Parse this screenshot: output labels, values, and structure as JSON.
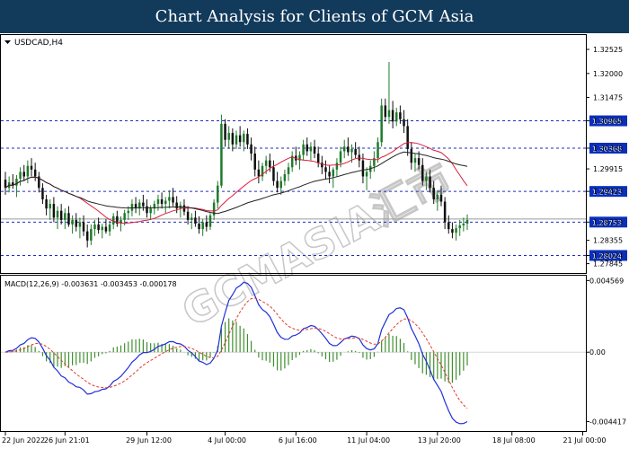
{
  "banner": {
    "title": "Chart Analysis for Clients of GCM Asia"
  },
  "watermark": {
    "text": "GCMASIA汇市"
  },
  "chart_data": [
    {
      "type": "candlestick",
      "symbol_label": "USDCAD,H4",
      "ylim": [
        1.277,
        1.328
      ],
      "y_ticks": [
        1.32525,
        1.32,
        1.31475,
        1.30965,
        1.30368,
        1.29915,
        1.29423,
        1.28753,
        1.28355,
        1.28024,
        1.27845
      ],
      "price_levels": [
        {
          "value": 1.30965,
          "label": "1.30965",
          "style": "dashed",
          "color": "#1e2dbf"
        },
        {
          "value": 1.30368,
          "label": "1.30368",
          "style": "dashed",
          "color": "#1e2dbf"
        },
        {
          "value": 1.29423,
          "label": "1.29423",
          "style": "dashed",
          "color": "#1e2dbf"
        },
        {
          "value": 1.28753,
          "label": "1.28753",
          "style": "dashed",
          "color": "#1e2dbf"
        },
        {
          "value": 1.28024,
          "label": "1.28024",
          "style": "dashed",
          "color": "#1e2dbf"
        }
      ],
      "current_price_line": {
        "value": 1.2882,
        "color": "#9a9a9a"
      },
      "candle_colors": {
        "up": "#1f7a2a",
        "down": "#101010"
      },
      "moving_averages": [
        {
          "color": "#d81e3c",
          "period": 20
        },
        {
          "color": "#222222",
          "period": 50
        }
      ],
      "x_tick_labels": [
        "22 Jun 2022",
        "26 Jun 21:01",
        "29 Jun 12:00",
        "4 Jul 00:00",
        "6 Jul 16:00",
        "11 Jul 04:00",
        "13 Jul 20:00",
        "18 Jul 08:00",
        "21 Jul 00:00"
      ],
      "x_tick_candles": [
        0,
        16,
        38,
        59,
        78,
        97,
        116,
        136,
        155
      ],
      "candles": [
        [
          1.2968,
          1.2985,
          1.2935,
          1.295
        ],
        [
          1.295,
          1.2975,
          1.294,
          1.2962
        ],
        [
          1.2962,
          1.298,
          1.2948,
          1.2955
        ],
        [
          1.2955,
          1.2978,
          1.293,
          1.297
        ],
        [
          1.297,
          1.2995,
          1.2955,
          1.2985
        ],
        [
          1.2985,
          1.3,
          1.2965,
          1.2975
        ],
        [
          1.2975,
          1.301,
          1.296,
          1.2998
        ],
        [
          1.2998,
          1.3015,
          1.2975,
          1.299
        ],
        [
          1.299,
          1.3005,
          1.2965,
          1.2975
        ],
        [
          1.2975,
          1.2985,
          1.294,
          1.295
        ],
        [
          1.295,
          1.296,
          1.2915,
          1.2925
        ],
        [
          1.2925,
          1.2935,
          1.289,
          1.2905
        ],
        [
          1.2905,
          1.2925,
          1.288,
          1.2915
        ],
        [
          1.2915,
          1.293,
          1.2875,
          1.2885
        ],
        [
          1.2885,
          1.291,
          1.286,
          1.29
        ],
        [
          1.29,
          1.2915,
          1.287,
          1.288
        ],
        [
          1.288,
          1.2905,
          1.286,
          1.2895
        ],
        [
          1.2895,
          1.291,
          1.2865,
          1.287
        ],
        [
          1.287,
          1.289,
          1.285,
          1.288
        ],
        [
          1.288,
          1.2895,
          1.2855,
          1.2865
        ],
        [
          1.2865,
          1.2885,
          1.284,
          1.2875
        ],
        [
          1.2875,
          1.289,
          1.2845,
          1.2855
        ],
        [
          1.2855,
          1.287,
          1.282,
          1.2835
        ],
        [
          1.2835,
          1.287,
          1.2825,
          1.286
        ],
        [
          1.286,
          1.288,
          1.2845,
          1.287
        ],
        [
          1.287,
          1.2885,
          1.285,
          1.2858
        ],
        [
          1.2858,
          1.2872,
          1.284,
          1.2865
        ],
        [
          1.2865,
          1.2882,
          1.285,
          1.2855
        ],
        [
          1.2855,
          1.2878,
          1.2845,
          1.287
        ],
        [
          1.287,
          1.2895,
          1.286,
          1.2888
        ],
        [
          1.2888,
          1.29,
          1.2865,
          1.2872
        ],
        [
          1.2872,
          1.2888,
          1.2855,
          1.288
        ],
        [
          1.288,
          1.2902,
          1.2868,
          1.2895
        ],
        [
          1.2895,
          1.291,
          1.288,
          1.29
        ],
        [
          1.29,
          1.2925,
          1.2888,
          1.2915
        ],
        [
          1.2915,
          1.293,
          1.2895,
          1.2905
        ],
        [
          1.2905,
          1.2925,
          1.289,
          1.2918
        ],
        [
          1.2918,
          1.2935,
          1.29,
          1.291
        ],
        [
          1.291,
          1.2925,
          1.2885,
          1.2895
        ],
        [
          1.2895,
          1.2912,
          1.288,
          1.2905
        ],
        [
          1.2905,
          1.2922,
          1.2892,
          1.2915
        ],
        [
          1.2915,
          1.2935,
          1.29,
          1.2925
        ],
        [
          1.2925,
          1.294,
          1.2905,
          1.2915
        ],
        [
          1.2915,
          1.293,
          1.2895,
          1.2922
        ],
        [
          1.2922,
          1.2945,
          1.2905,
          1.293
        ],
        [
          1.293,
          1.295,
          1.291,
          1.2918
        ],
        [
          1.2918,
          1.2932,
          1.2895,
          1.2905
        ],
        [
          1.2905,
          1.292,
          1.2885,
          1.2912
        ],
        [
          1.2912,
          1.2925,
          1.289,
          1.2898
        ],
        [
          1.2898,
          1.291,
          1.287,
          1.288
        ],
        [
          1.288,
          1.2895,
          1.286,
          1.2885
        ],
        [
          1.2885,
          1.29,
          1.2865,
          1.2872
        ],
        [
          1.2872,
          1.2888,
          1.285,
          1.286
        ],
        [
          1.286,
          1.2882,
          1.2845,
          1.2875
        ],
        [
          1.2875,
          1.289,
          1.2855,
          1.2865
        ],
        [
          1.2865,
          1.2895,
          1.2858,
          1.289
        ],
        [
          1.289,
          1.2925,
          1.288,
          1.2918
        ],
        [
          1.2918,
          1.2965,
          1.2905,
          1.2955
        ],
        [
          1.2955,
          1.311,
          1.295,
          1.309
        ],
        [
          1.309,
          1.31,
          1.304,
          1.3055
        ],
        [
          1.3055,
          1.3085,
          1.3035,
          1.307
        ],
        [
          1.307,
          1.308,
          1.303,
          1.3045
        ],
        [
          1.3045,
          1.3075,
          1.3035,
          1.3065
        ],
        [
          1.3065,
          1.3085,
          1.304,
          1.305
        ],
        [
          1.305,
          1.3075,
          1.303,
          1.3068
        ],
        [
          1.3068,
          1.308,
          1.3035,
          1.3045
        ],
        [
          1.3045,
          1.306,
          1.301,
          1.3025
        ],
        [
          1.3025,
          1.304,
          1.2975,
          1.299
        ],
        [
          1.299,
          1.301,
          1.296,
          1.2975
        ],
        [
          1.2975,
          1.3005,
          1.2965,
          1.2998
        ],
        [
          1.2998,
          1.302,
          1.298,
          1.301
        ],
        [
          1.301,
          1.3025,
          1.2985,
          1.2995
        ],
        [
          1.2995,
          1.301,
          1.2955,
          1.2965
        ],
        [
          1.2965,
          1.2985,
          1.294,
          1.295
        ],
        [
          1.295,
          1.2975,
          1.2935,
          1.2965
        ],
        [
          1.2965,
          1.299,
          1.2955,
          1.298
        ],
        [
          1.298,
          1.3005,
          1.2965,
          1.2995
        ],
        [
          1.2995,
          1.303,
          1.2985,
          1.302
        ],
        [
          1.302,
          1.304,
          1.3,
          1.301
        ],
        [
          1.301,
          1.303,
          1.299,
          1.3022
        ],
        [
          1.3022,
          1.3055,
          1.301,
          1.3045
        ],
        [
          1.3045,
          1.306,
          1.302,
          1.303
        ],
        [
          1.303,
          1.305,
          1.301,
          1.304
        ],
        [
          1.304,
          1.3055,
          1.3015,
          1.3025
        ],
        [
          1.3025,
          1.304,
          1.2995,
          1.3005
        ],
        [
          1.3005,
          1.302,
          1.298,
          1.2995
        ],
        [
          1.2995,
          1.301,
          1.297,
          1.2985
        ],
        [
          1.2985,
          1.3,
          1.296,
          1.2975
        ],
        [
          1.2975,
          1.2995,
          1.295,
          1.299
        ],
        [
          1.299,
          1.3015,
          1.2975,
          1.3005
        ],
        [
          1.3005,
          1.304,
          1.2995,
          1.303
        ],
        [
          1.303,
          1.3055,
          1.3015,
          1.304
        ],
        [
          1.304,
          1.306,
          1.302,
          1.3028
        ],
        [
          1.3028,
          1.3045,
          1.3005,
          1.3035
        ],
        [
          1.3035,
          1.305,
          1.3015,
          1.3022
        ],
        [
          1.3022,
          1.304,
          1.2995,
          1.301
        ],
        [
          1.301,
          1.3025,
          1.296,
          1.2975
        ],
        [
          1.2975,
          1.2995,
          1.2945,
          1.2985
        ],
        [
          1.2985,
          1.301,
          1.297,
          1.2998
        ],
        [
          1.2998,
          1.303,
          1.2985,
          1.3015
        ],
        [
          1.3015,
          1.306,
          1.3005,
          1.305
        ],
        [
          1.305,
          1.3145,
          1.304,
          1.313
        ],
        [
          1.313,
          1.3145,
          1.3095,
          1.3105
        ],
        [
          1.3105,
          1.3225,
          1.309,
          1.312
        ],
        [
          1.312,
          1.314,
          1.308,
          1.3095
        ],
        [
          1.3095,
          1.3125,
          1.3085,
          1.3115
        ],
        [
          1.3115,
          1.313,
          1.309,
          1.31
        ],
        [
          1.31,
          1.312,
          1.307,
          1.3085
        ],
        [
          1.3085,
          1.31,
          1.302,
          1.3035
        ],
        [
          1.3035,
          1.305,
          1.299,
          1.3005
        ],
        [
          1.3005,
          1.3025,
          1.2985,
          1.3015
        ],
        [
          1.3015,
          1.303,
          1.299,
          1.3
        ],
        [
          1.3,
          1.3015,
          1.2955,
          1.2965
        ],
        [
          1.2965,
          1.2985,
          1.2945,
          1.2975
        ],
        [
          1.2975,
          1.299,
          1.294,
          1.295
        ],
        [
          1.295,
          1.2965,
          1.2915,
          1.2925
        ],
        [
          1.2925,
          1.2945,
          1.29,
          1.2935
        ],
        [
          1.2935,
          1.2955,
          1.291,
          1.292
        ],
        [
          1.292,
          1.293,
          1.286,
          1.2875
        ],
        [
          1.2875,
          1.289,
          1.285,
          1.286
        ],
        [
          1.286,
          1.2875,
          1.284,
          1.2852
        ],
        [
          1.2852,
          1.287,
          1.2835,
          1.2862
        ],
        [
          1.2862,
          1.288,
          1.2845,
          1.2868
        ],
        [
          1.2868,
          1.2885,
          1.2855,
          1.2872
        ],
        [
          1.2872,
          1.2892,
          1.2858,
          1.288
        ]
      ]
    },
    {
      "type": "line",
      "indicator_label": "MACD(12,26,9) -0.003631 -0.003453 -0.000178",
      "ylim": [
        -0.00485,
        0.00476
      ],
      "y_ticks": [
        0.004569,
        0.0,
        -0.004417
      ],
      "y_tick_labels": [
        "0.004569",
        "0.00",
        "-0.004417"
      ],
      "series_colors": {
        "macd": "#1f2fd9",
        "signal": "#e23a2a",
        "histogram": "#3f8f2f"
      }
    }
  ]
}
